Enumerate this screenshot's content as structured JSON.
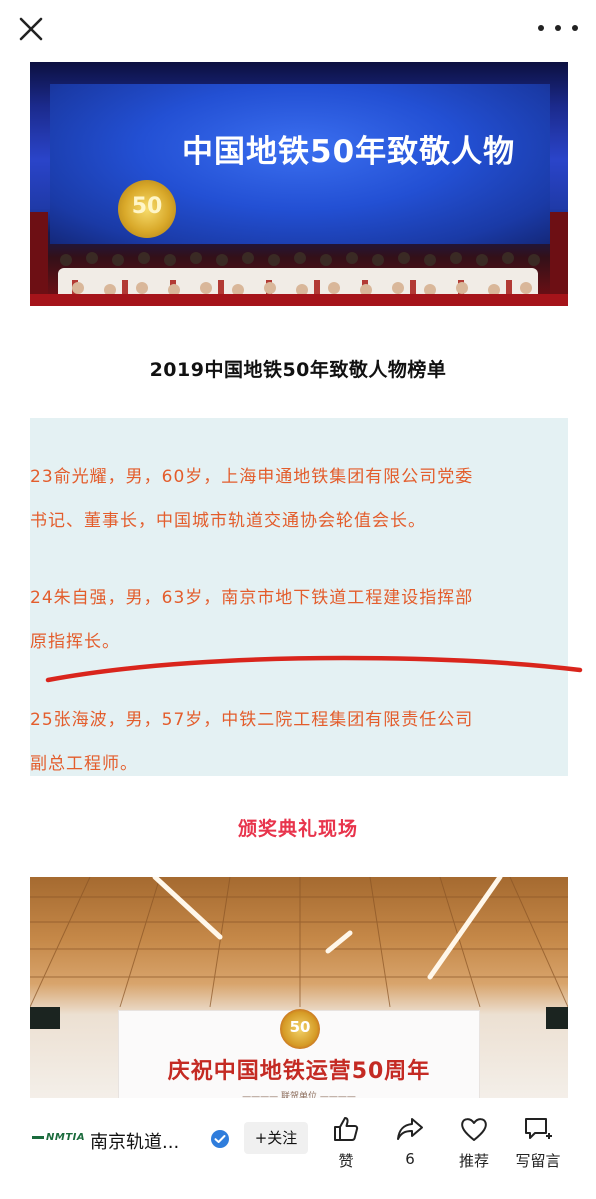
{
  "header": {
    "close_icon": "close-icon",
    "more_icon": "more-dots-icon"
  },
  "photo1": {
    "screen_text": "中国地铁50年致敬人物",
    "medal_text": "50"
  },
  "article": {
    "list_title": "2019中国地铁50年致敬人物榜单",
    "entries": [
      {
        "line1": "23俞光耀，男，60岁，上海申通地铁集团有限公司党委",
        "line2": "书记、董事长，中国城市轨道交通协会轮值会长。"
      },
      {
        "line1": "24朱自强，男，63岁，南京市地下铁道工程建设指挥部",
        "line2": "原指挥长。"
      },
      {
        "line1": "25张海波，男，57岁，中铁二院工程集团有限责任公司",
        "line2": "副总工程师。"
      }
    ],
    "section_heading": "颁奖典礼现场",
    "entry_color": "#e35d2c",
    "highlight_bg": "#e4f1f3",
    "heading_color": "#e8344c"
  },
  "photo2": {
    "banner_text": "庆祝中国地铁运营50周年",
    "banner_sub": "———— 联贺单位 ————",
    "logo_text": "50"
  },
  "bottom_bar": {
    "account_logo": "NMTIA",
    "account_name": "南京轨道...",
    "follow_label": "+关注",
    "like_label": "赞",
    "share_count": "6",
    "recommend_label": "推荐",
    "comment_label": "写留言"
  }
}
